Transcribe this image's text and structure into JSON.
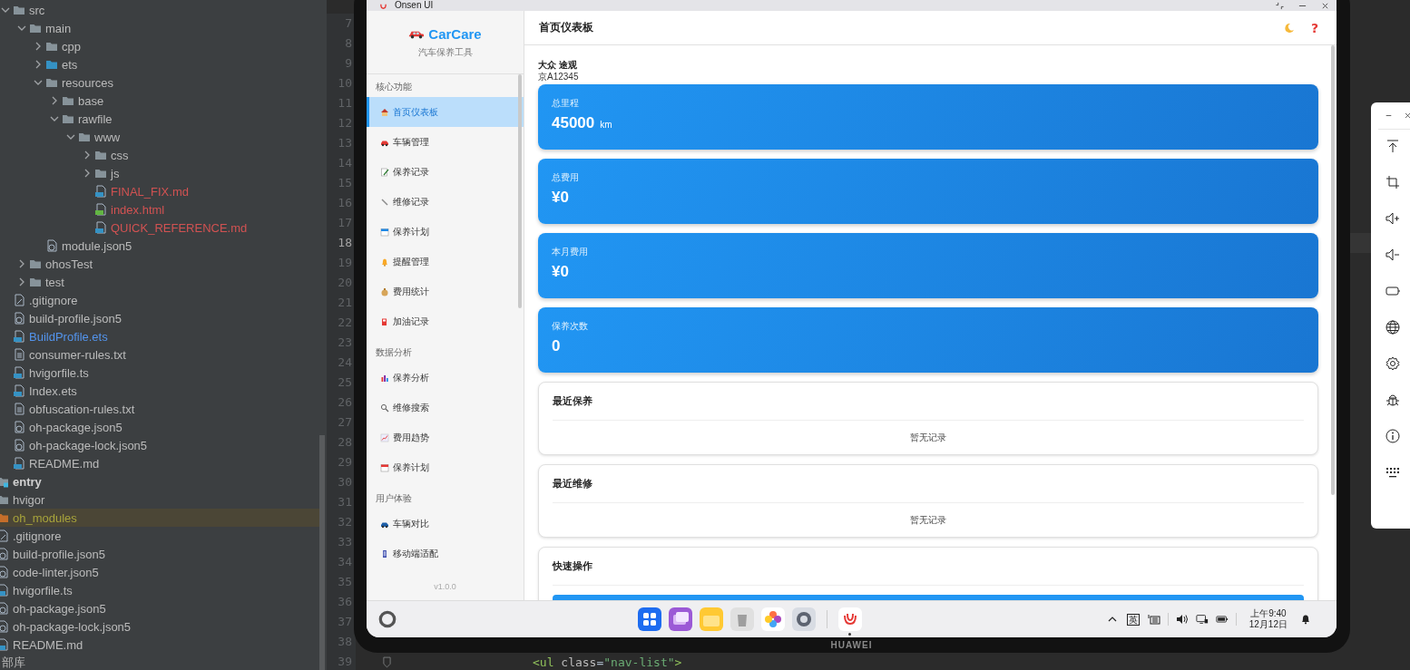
{
  "project_tree": [
    {
      "children": [
        {
          "children": [
            {
              "label": "src",
              "kind": "folder",
              "expanded": true,
              "selected": false,
              "children": [
                {
                  "label": "main",
                  "kind": "folder",
                  "expanded": true,
                  "selected": false,
                  "children": [
                    {
                      "label": "cpp",
                      "kind": "folder",
                      "expanded": false,
                      "selected": false
                    },
                    {
                      "label": "ets",
                      "kind": "source-folder",
                      "expanded": false,
                      "selected": false
                    },
                    {
                      "label": "resources",
                      "kind": "folder",
                      "expanded": true,
                      "selected": false,
                      "children": [
                        {
                          "label": "base",
                          "kind": "folder",
                          "expanded": false,
                          "selected": false
                        },
                        {
                          "label": "rawfile",
                          "kind": "folder",
                          "expanded": true,
                          "selected": false,
                          "children": [
                            {
                              "label": "www",
                              "kind": "folder",
                              "expanded": true,
                              "selected": false,
                              "children": [
                                {
                                  "label": "css",
                                  "kind": "folder",
                                  "expanded": false,
                                  "selected": false
                                },
                                {
                                  "label": "js",
                                  "kind": "folder",
                                  "expanded": false,
                                  "selected": false
                                },
                                {
                                  "label": "FINAL_FIX.md",
                                  "kind": "md",
                                  "selected": false,
                                  "color": "#d25252"
                                },
                                {
                                  "label": "index.html",
                                  "kind": "html",
                                  "selected": false,
                                  "color": "#d25252"
                                },
                                {
                                  "label": "QUICK_REFERENCE.md",
                                  "kind": "md",
                                  "selected": false,
                                  "color": "#d25252"
                                }
                              ]
                            }
                          ]
                        }
                      ]
                    },
                    {
                      "label": "module.json5",
                      "kind": "json",
                      "selected": false
                    }
                  ]
                },
                {
                  "label": "ohosTest",
                  "kind": "folder",
                  "expanded": false,
                  "selected": false
                },
                {
                  "label": "test",
                  "kind": "folder",
                  "expanded": false,
                  "selected": false
                }
              ]
            },
            {
              "label": ".gitignore",
              "kind": "ignore",
              "selected": false
            },
            {
              "label": "build-profile.json5",
              "kind": "json",
              "selected": false
            },
            {
              "label": "BuildProfile.ets",
              "kind": "ets",
              "selected": false,
              "color": "#5394ec"
            },
            {
              "label": "consumer-rules.txt",
              "kind": "txt",
              "selected": false
            },
            {
              "label": "hvigorfile.ts",
              "kind": "ts",
              "selected": false
            },
            {
              "label": "Index.ets",
              "kind": "ets",
              "selected": false
            },
            {
              "label": "obfuscation-rules.txt",
              "kind": "txt",
              "selected": false
            },
            {
              "label": "oh-package.json5",
              "kind": "json",
              "selected": false
            },
            {
              "label": "oh-package-lock.json5",
              "kind": "json",
              "selected": false
            },
            {
              "label": "README.md",
              "kind": "md",
              "selected": false
            }
          ]
        },
        {
          "label": "entry",
          "kind": "module",
          "selected": false
        },
        {
          "label": "hvigor",
          "kind": "folder",
          "selected": false
        },
        {
          "label": "oh_modules",
          "kind": "excluded-folder",
          "selected": true,
          "color": "#a7a33b"
        },
        {
          "label": ".gitignore",
          "kind": "ignore",
          "selected": false
        },
        {
          "label": "build-profile.json5",
          "kind": "json",
          "selected": false
        },
        {
          "label": "code-linter.json5",
          "kind": "json",
          "selected": false
        },
        {
          "label": "hvigorfile.ts",
          "kind": "ts",
          "selected": false
        },
        {
          "label": "oh-package.json5",
          "kind": "json",
          "selected": false
        },
        {
          "label": "oh-package-lock.json5",
          "kind": "json",
          "selected": false
        },
        {
          "label": "README.md",
          "kind": "md",
          "selected": false
        }
      ]
    },
    {
      "label": "部库",
      "kind": "library",
      "selected": false
    }
  ],
  "editor": {
    "lines": [
      {
        "text": "7",
        "current": false
      },
      {
        "text": "8",
        "current": false
      },
      {
        "text": "9",
        "current": false
      },
      {
        "text": "10",
        "current": false
      },
      {
        "text": "11",
        "current": false
      },
      {
        "text": "12",
        "current": false
      },
      {
        "text": "13",
        "current": false
      },
      {
        "text": "14",
        "current": false
      },
      {
        "text": "15",
        "current": false
      },
      {
        "text": "16",
        "current": false
      },
      {
        "text": "17",
        "current": false
      },
      {
        "text": "18",
        "current": true
      },
      {
        "text": "19",
        "current": false
      },
      {
        "text": "20",
        "current": false
      },
      {
        "text": "21",
        "current": false
      },
      {
        "text": "22",
        "current": false
      },
      {
        "text": "23",
        "current": false
      },
      {
        "text": "24",
        "current": false
      },
      {
        "text": "25",
        "current": false
      },
      {
        "text": "26",
        "current": false
      },
      {
        "text": "27",
        "current": false
      },
      {
        "text": "28",
        "current": false
      },
      {
        "text": "29",
        "current": false
      },
      {
        "text": "30",
        "current": false
      },
      {
        "text": "31",
        "current": false
      },
      {
        "text": "32",
        "current": false
      },
      {
        "text": "33",
        "current": false
      },
      {
        "text": "34",
        "current": false
      },
      {
        "text": "35",
        "current": false
      },
      {
        "text": "36",
        "current": false
      },
      {
        "text": "37",
        "current": false
      },
      {
        "text": "38",
        "current": false
      },
      {
        "text": "39",
        "current": false,
        "code": [
          {
            "text": "<ul",
            "kind": "tag"
          },
          {
            "text": " class",
            "kind": "attr"
          },
          {
            "text": "=",
            "kind": "plain"
          },
          {
            "text": "\"nav-list\"",
            "kind": "string"
          },
          {
            "text": ">",
            "kind": "tag"
          }
        ]
      }
    ]
  },
  "emulator": {
    "title_bar": {
      "title": "Onsen UI"
    },
    "sidebar": {
      "brand": "CarCare",
      "subtitle": "汽车保养工具",
      "sections": [
        {
          "title": "核心功能",
          "items": [
            {
              "label": "首页仪表板",
              "selected": true
            },
            {
              "label": "车辆管理",
              "selected": false
            },
            {
              "label": "保养记录",
              "selected": false
            },
            {
              "label": "维修记录",
              "selected": false
            },
            {
              "label": "保养计划",
              "selected": false
            },
            {
              "label": "提醒管理",
              "selected": false
            },
            {
              "label": "费用统计",
              "selected": false
            },
            {
              "label": "加油记录",
              "selected": false
            }
          ]
        },
        {
          "title": "数据分析",
          "items": [
            {
              "label": "保养分析",
              "selected": false
            },
            {
              "label": "维修搜索",
              "selected": false
            },
            {
              "label": "费用趋势",
              "selected": false
            },
            {
              "label": "保养计划",
              "selected": false
            }
          ]
        },
        {
          "title": "用户体验",
          "items": [
            {
              "label": "车辆对比",
              "selected": false
            },
            {
              "label": "移动端适配",
              "selected": false
            }
          ]
        }
      ],
      "version": "v1.0.0"
    },
    "header": {
      "title": "首页仪表板",
      "help": "?"
    },
    "vehicle": {
      "name": "大众 途观",
      "plate": "京A12345"
    },
    "stats": [
      {
        "label": "总里程",
        "value": "45000",
        "unit": "km"
      },
      {
        "label": "总费用",
        "value": "¥0"
      },
      {
        "label": "本月费用",
        "value": "¥0"
      },
      {
        "label": "保养次数",
        "value": "0"
      }
    ],
    "panels": [
      {
        "title": "最近保养",
        "kind": "empty",
        "empty_text": "暂无记录"
      },
      {
        "title": "最近维修",
        "kind": "empty",
        "empty_text": "暂无记录"
      },
      {
        "title": "快速操作",
        "kind": "actions"
      }
    ],
    "taskbar": {
      "apps": [
        {
          "running": false
        },
        {
          "running": false
        },
        {
          "running": false
        },
        {
          "running": false
        },
        {
          "running": false
        },
        {
          "running": false
        },
        {
          "running": true
        }
      ],
      "ime": "英",
      "time": "上午9:40",
      "date": "12月12日"
    }
  },
  "device_brand": "HUAWEI"
}
